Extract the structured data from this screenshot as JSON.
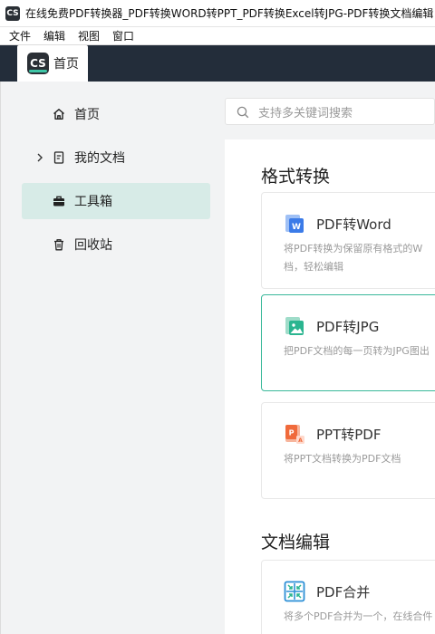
{
  "window": {
    "app_icon_text": "CS",
    "title": "在线免费PDF转换器_PDF转换WORD转PPT_PDF转换Excel转JPG-PDF转换文档编辑"
  },
  "menubar": {
    "items": [
      "文件",
      "编辑",
      "视图",
      "窗口"
    ]
  },
  "tabs": {
    "active": {
      "logo": "CS",
      "label": "首页"
    }
  },
  "sidebar": {
    "items": [
      {
        "label": "首页",
        "icon": "home-icon"
      },
      {
        "label": "我的文档",
        "icon": "document-icon",
        "expander": "chevron-right-icon"
      },
      {
        "label": "工具箱",
        "icon": "toolbox-icon",
        "active": true
      },
      {
        "label": "回收站",
        "icon": "trash-icon"
      }
    ]
  },
  "search": {
    "placeholder": "支持多关键词搜索"
  },
  "sections": [
    {
      "title": "格式转换",
      "cards": [
        {
          "title": "PDF转Word",
          "desc": "将PDF转换为保留原有格式的W档，轻松编辑",
          "icon": "word-file-icon"
        },
        {
          "title": "PDF转JPG",
          "desc": "把PDF文档的每一页转为JPG图出",
          "icon": "image-file-icon",
          "selected": true
        },
        {
          "title": "PPT转PDF",
          "desc": "将PPT文档转换为PDF文档",
          "icon": "ppt-file-icon"
        }
      ]
    },
    {
      "title": "文档编辑",
      "cards": [
        {
          "title": "PDF合并",
          "desc": "将多个PDF合并为一个，在线合件",
          "icon": "merge-icon"
        }
      ]
    }
  ],
  "colors": {
    "accent": "#39b89a",
    "sidebar_active_bg": "#d7ebe7",
    "tabbar_bg": "#232d3a",
    "word_blue": "#3b7be8",
    "jpg_teal": "#2bb590",
    "ppt_orange": "#f06a3b"
  }
}
